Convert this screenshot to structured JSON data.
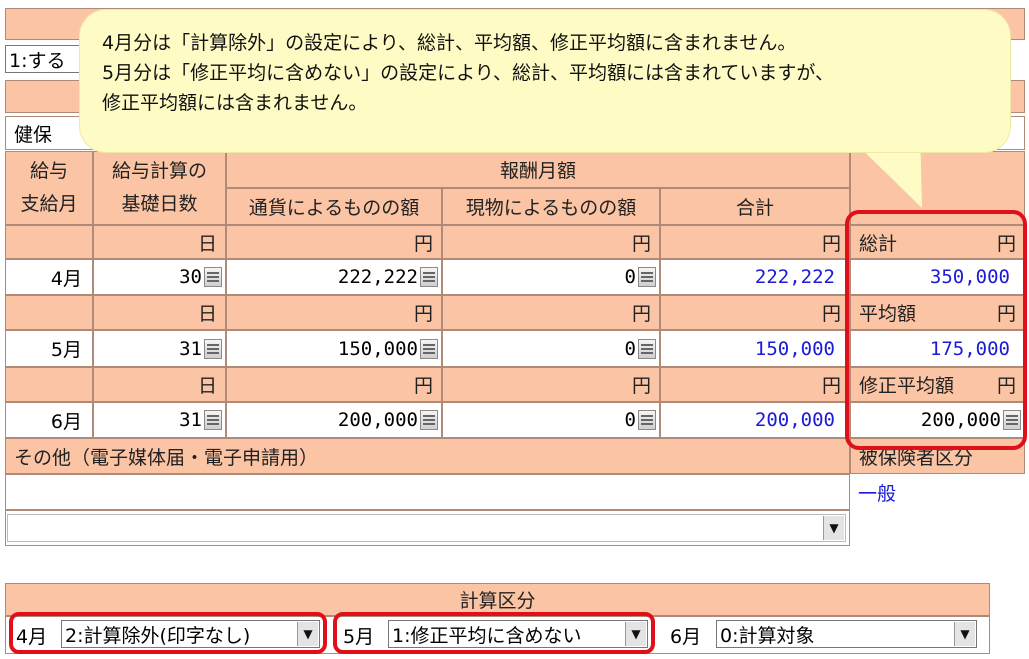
{
  "top_remnants": {
    "fragment_a": "1:する",
    "fragment_b": "健保"
  },
  "callout": {
    "line1": "4月分は「計算除外」の設定により、総計、平均額、修正平均額に含まれません。",
    "line2": "5月分は「修正平均に含めない」の設定により、総計、平均額には含まれていますが、",
    "line3": "修正平均額には含まれません。"
  },
  "table": {
    "col_pay_month": [
      "給与",
      "支給月"
    ],
    "col_base_days": [
      "給与計算の",
      "基礎日数"
    ],
    "group_remuneration": "報酬月額",
    "col_currency": "通貨によるものの額",
    "col_goods": "現物によるものの額",
    "col_total": "合計",
    "unit_day": "日",
    "unit_yen": "円",
    "rows": [
      {
        "month": "4月",
        "days": "30",
        "currency": "222,222",
        "goods": "0",
        "total": "222,222"
      },
      {
        "month": "5月",
        "days": "31",
        "currency": "150,000",
        "goods": "0",
        "total": "150,000"
      },
      {
        "month": "6月",
        "days": "31",
        "currency": "200,000",
        "goods": "0",
        "total": "200,000"
      }
    ]
  },
  "summary": {
    "total_label": "総計",
    "total_value": "350,000",
    "average_label": "平均額",
    "average_value": "175,000",
    "modified_average_label": "修正平均額",
    "modified_average_value": "200,000"
  },
  "other": {
    "label": "その他（電子媒体届・電子申請用）",
    "insured_label": "被保険者区分",
    "insured_value": "一般"
  },
  "calc_section": {
    "title": "計算区分",
    "items": [
      {
        "month": "4月",
        "value": "2:計算除外(印字なし)"
      },
      {
        "month": "5月",
        "value": "1:修正平均に含めない"
      },
      {
        "month": "6月",
        "value": "0:計算対象"
      }
    ]
  },
  "dropdown_arrow": "▼",
  "colors": {
    "header_bg": "#fbc4a4",
    "callout_bg": "#fffbc4",
    "highlight": "#e0101a",
    "value_text": "#1a1ad8"
  }
}
